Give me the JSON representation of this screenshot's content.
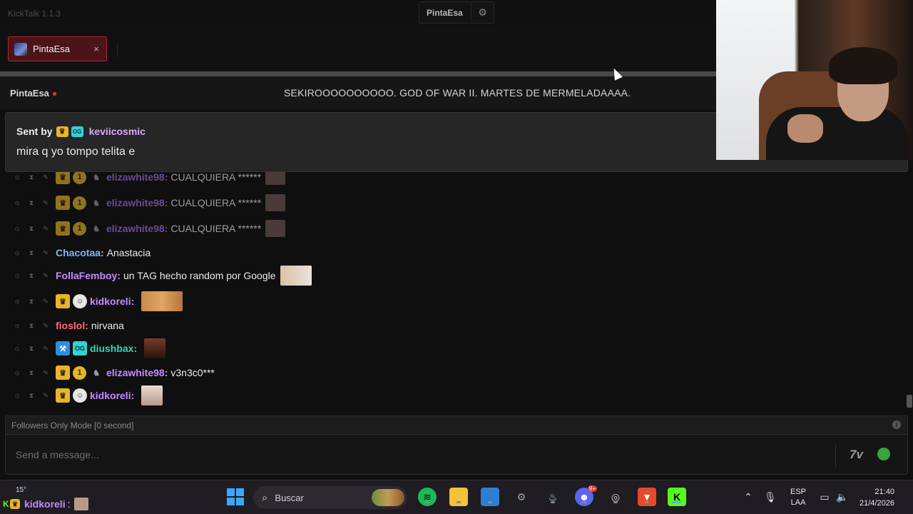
{
  "app": {
    "title": "KickTalk 1.1.3"
  },
  "top_center": {
    "label": "PintaEsa",
    "icon": "gear-icon"
  },
  "tabs": [
    {
      "label": "PintaEsa",
      "close": "×"
    }
  ],
  "channel": {
    "name": "PintaEsa",
    "stream_title": "SEKIROOOOOOOOOO. GOD OF WAR II. MARTES DE MERMELADAAAA."
  },
  "sent_by": {
    "prefix": "Sent by",
    "username": "keviicosmic",
    "message": "mira q yo tompo telita e"
  },
  "messages": [
    {
      "username": "elizawhite98:",
      "text": "CUALQUIERA ******",
      "color": "#b07cff",
      "dim": true
    },
    {
      "username": "elizawhite98:",
      "text": "CUALQUIERA ******",
      "color": "#b07cff",
      "dim": true
    },
    {
      "username": "elizawhite98:",
      "text": "CUALQUIERA ******",
      "color": "#b07cff",
      "dim": true
    },
    {
      "username": "Chacotaa:",
      "text": "Anastacia",
      "color": "#7fb6ff"
    },
    {
      "username": "FollaFemboy:",
      "text": "un TAG hecho random por Google",
      "color": "#c38cff"
    },
    {
      "username": "kidkoreli:",
      "text": "",
      "color": "#c38cff"
    },
    {
      "username": "fioslol:",
      "text": "nirvana",
      "color": "#ff6b7f"
    },
    {
      "username": "diushbax:",
      "text": "",
      "color": "#33d6b8"
    },
    {
      "username": "elizawhite98:",
      "text": "v3n3c0***",
      "color": "#c38cff"
    },
    {
      "username": "kidkoreli:",
      "text": "",
      "color": "#c38cff"
    }
  ],
  "badges": {
    "one": "1",
    "og": "OG"
  },
  "input": {
    "followers_mode": "Followers Only Mode [0 second]",
    "placeholder": "Send a message...",
    "seventv": "7v"
  },
  "taskbar": {
    "weather": "15°",
    "mini_user": "kidkoreli",
    "mini_colon": ":",
    "search_label": "Buscar",
    "spotify_badge": "9+",
    "lang_top": "ESP",
    "lang_bottom": "LAA",
    "time": "21:40",
    "date": "21/4/2026"
  },
  "colors": {
    "tab_active": "#b3262e",
    "kick_green": "#53fc18",
    "crown_badge": "#e8b42a"
  }
}
